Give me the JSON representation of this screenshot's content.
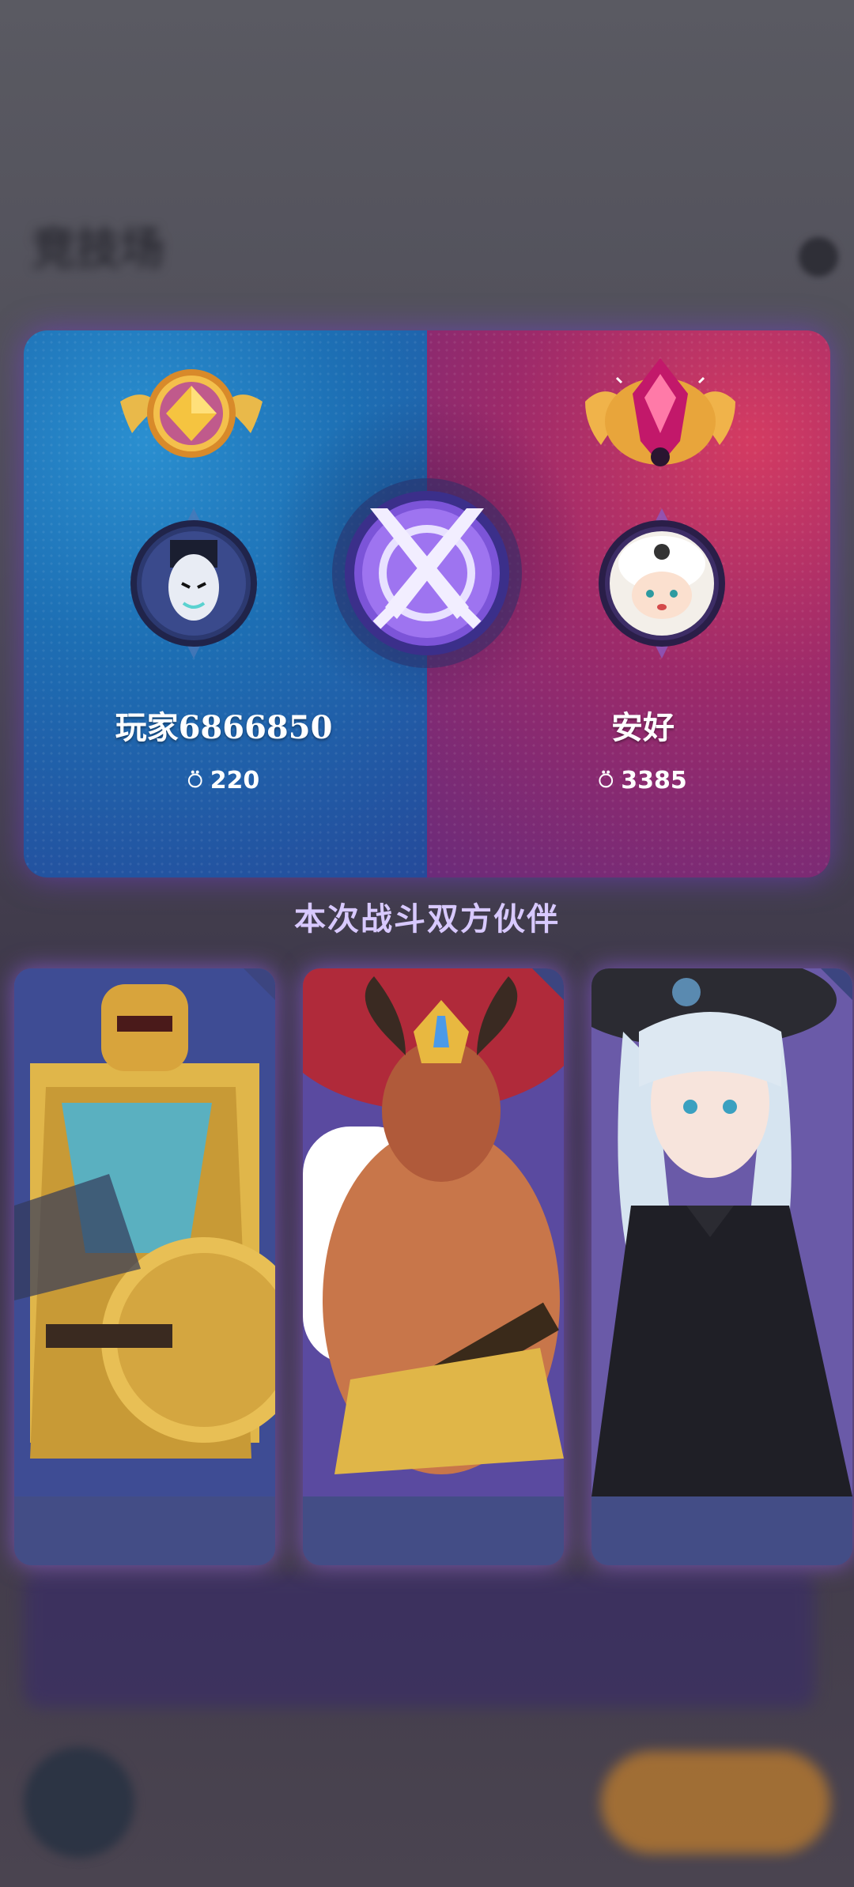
{
  "background": {
    "title": "竞技场"
  },
  "battle": {
    "left_player": {
      "name": "玩家6866850",
      "score": "220",
      "color": "#1d6fb4",
      "rank_icon": "gold-gem-wing-badge-icon",
      "avatar_icon": "dark-mask-hero-avatar-icon"
    },
    "right_player": {
      "name": "安好",
      "score": "3385",
      "color": "#c0305c",
      "rank_icon": "crimson-crown-wing-badge-icon",
      "avatar_icon": "white-hair-kid-avatar-icon"
    },
    "vs_icon": "crossed-swords-icon",
    "score_icon": "medal-icon"
  },
  "partners": {
    "title": "本次战斗双方伙伴",
    "cards": [
      {
        "character": "golden-armored-knight-with-shield",
        "accent": "#e2b84a"
      },
      {
        "character": "horned-demon-king-with-spear",
        "accent": "#c8763b"
      },
      {
        "character": "gothic-girl-in-black-hat",
        "accent": "#2b2b30"
      }
    ]
  }
}
